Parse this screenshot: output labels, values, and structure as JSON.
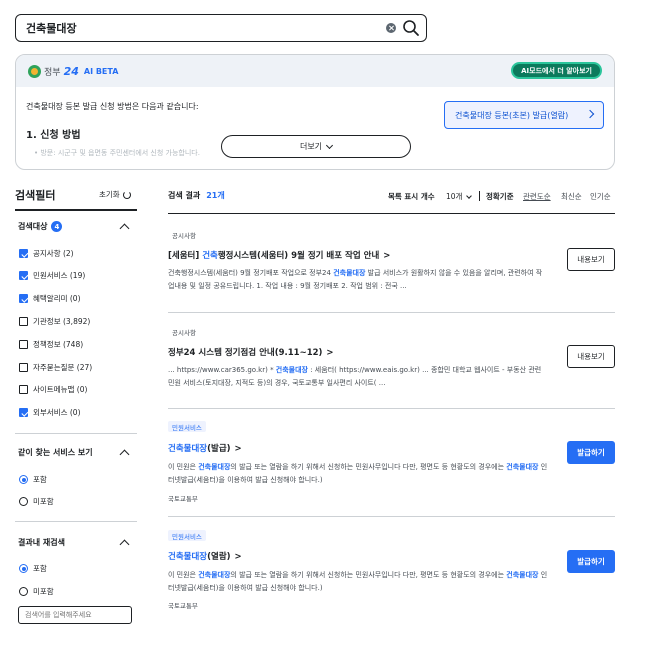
{
  "search": {
    "value": "건축물대장"
  },
  "ai_panel": {
    "brand_text": "정부",
    "brand_num": "24",
    "beta_label": "AI BETA",
    "mode_button": "AI모드에서 더 알아보기",
    "intro": "건축물대장 등본 발급 신청 방법은 다음과 같습니다:",
    "heading": "1. 신청 방법",
    "cut_text": "• 방문: 시군구 및 읍면동 주민센터에서 신청 가능합니다.",
    "link_button": "건축물대장 등본(초본) 발급(열람)",
    "more_button": "더보기"
  },
  "filter": {
    "title": "검색필터",
    "reset": "초기화",
    "groups": [
      {
        "title": "검색대상",
        "badge": "4",
        "items": [
          {
            "label": "공지사항 (2)",
            "checked": true
          },
          {
            "label": "민원서비스 (19)",
            "checked": true
          },
          {
            "label": "혜택알리미 (0)",
            "checked": true
          },
          {
            "label": "기관정보 (3,892)",
            "checked": false
          },
          {
            "label": "정책정보 (748)",
            "checked": false
          },
          {
            "label": "자주묻는질문 (27)",
            "checked": false
          },
          {
            "label": "사이트메뉴맵 (0)",
            "checked": false
          },
          {
            "label": "외부서비스 (0)",
            "checked": true
          }
        ]
      },
      {
        "title": "같이 찾는 서비스 보기",
        "options": [
          {
            "label": "포함",
            "selected": true
          },
          {
            "label": "미포함",
            "selected": false
          }
        ]
      },
      {
        "title": "결과내 재검색",
        "options": [
          {
            "label": "포함",
            "selected": true
          },
          {
            "label": "미포함",
            "selected": false
          }
        ],
        "input_placeholder": "검색어를 입력해주세요"
      }
    ]
  },
  "results": {
    "label": "검색 결과",
    "count": "21개",
    "per_page_label": "목록 표시 개수",
    "per_page_value": "10개",
    "sorts": [
      "정확기준",
      "관련도순",
      "최신순",
      "인기순"
    ],
    "items": [
      {
        "category": "공시사항",
        "title_pre": "[세움터] ",
        "title_hl": "건축",
        "title_post": "행정시스템(세움터) 9월 정기 배포 작업 안내",
        "desc_1": "건축행정시스템(세움터) 9월 정기배포 작업으로 정부24 ",
        "desc_hl": "건축물대장",
        "desc_2": " 발급 서비스가 원활하지 않을 수 있음을 알리며, 관련하여 작업내용 및 일정 공유드립니다. 1. 작업 내용 : 9월 정기배포 2. 작업 범위 : 전국 ...",
        "button": "내용보기"
      },
      {
        "category": "공시사항",
        "title_pre": "정부24 시스템 정기점검 안내(9.11~12)",
        "desc_1": "... https://www.car365.go.kr) * ",
        "desc_hl": "건축물대장",
        "desc_2": " : 세움터( https://www.eais.go.kr) ... 종합민 대학교 웹사이트 - 부동산 관련 민원 서비스(토지대장, 지적도 등)의 경우, 국토교통부 일사편리 사이트( ...",
        "button": "내용보기"
      },
      {
        "category": "민원서비스",
        "title_hl": "건축물대장",
        "title_post": "(발급)",
        "desc_1": "이 민원은 ",
        "desc_hl": "건축물대장",
        "desc_2": "의 발급 또는 열람을 하기 위해서 신청하는 민원사무입니다 다만, 평면도 등 현황도의 경우에는 ",
        "desc_hl2": "건축물대장",
        "desc_3": " 인터넷발급(세움터)을 이용하여 발급 신청해야 합니다.)",
        "org": "국토교통부",
        "button": "발급하기"
      },
      {
        "category": "민원서비스",
        "title_hl": "건축물대장",
        "title_post": "(열람)",
        "desc_1": "이 민원은 ",
        "desc_hl": "건축물대장",
        "desc_2": "의 발급 또는 열람을 하기 위해서 신청하는 민원사무입니다 다만, 평면도 등 현황도의 경우에는 ",
        "desc_hl2": "건축물대장",
        "desc_3": " 인터넷발급(세움터)을 이용하여 발급 신청해야 합니다.)",
        "org": "국토교통부",
        "button": "발급하기"
      }
    ]
  }
}
